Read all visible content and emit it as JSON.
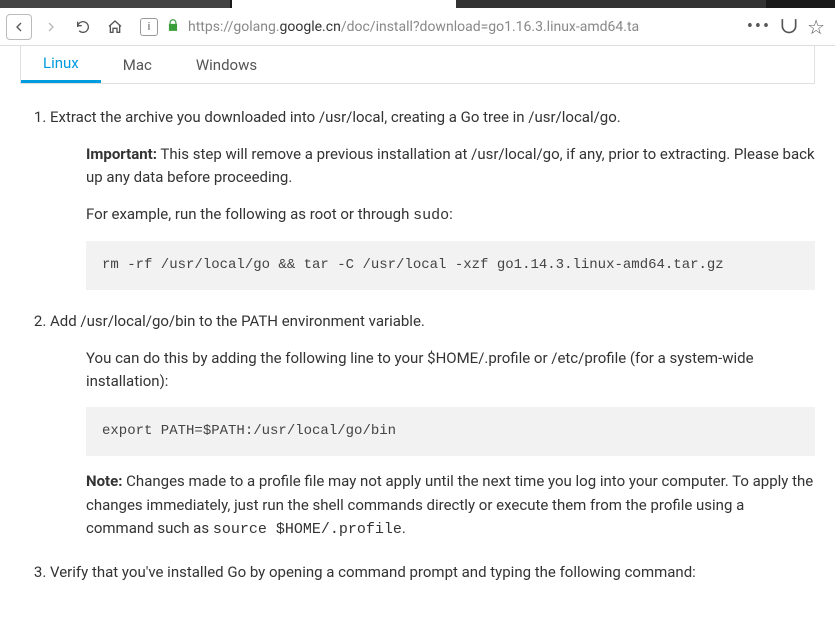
{
  "browser": {
    "url_prefix": "https://golang.",
    "url_bold": "google.cn",
    "url_suffix": "/doc/install?download=go1.16.3.linux-amd64.ta"
  },
  "tabs": {
    "t0": "Linux",
    "t1": "Mac",
    "t2": "Windows"
  },
  "step1": {
    "lead": "Extract the archive you downloaded into /usr/local, creating a Go tree in /usr/local/go.",
    "imp_label": "Important:",
    "imp_text": " This step will remove a previous installation at /usr/local/go, if any, prior to extracting. Please back up any data before proceeding.",
    "example_pre": "For example, run the following as root or through ",
    "example_code": "sudo",
    "example_post": ":",
    "cmd": "rm -rf /usr/local/go && tar -C /usr/local -xzf go1.14.3.linux-amd64.tar.gz"
  },
  "step2": {
    "lead": "Add /usr/local/go/bin to the PATH environment variable.",
    "desc": "You can do this by adding the following line to your $HOME/.profile or /etc/profile (for a system-wide installation):",
    "cmd": "export PATH=$PATH:/usr/local/go/bin",
    "note_label": "Note:",
    "note_a": " Changes made to a profile file may not apply until the next time you log into your computer. To apply the changes immediately, just run the shell commands directly or execute them from the profile using a command such as ",
    "note_code": "source $HOME/.profile",
    "note_b": "."
  },
  "step3": {
    "lead": "Verify that you've installed Go by opening a command prompt and typing the following command:"
  }
}
